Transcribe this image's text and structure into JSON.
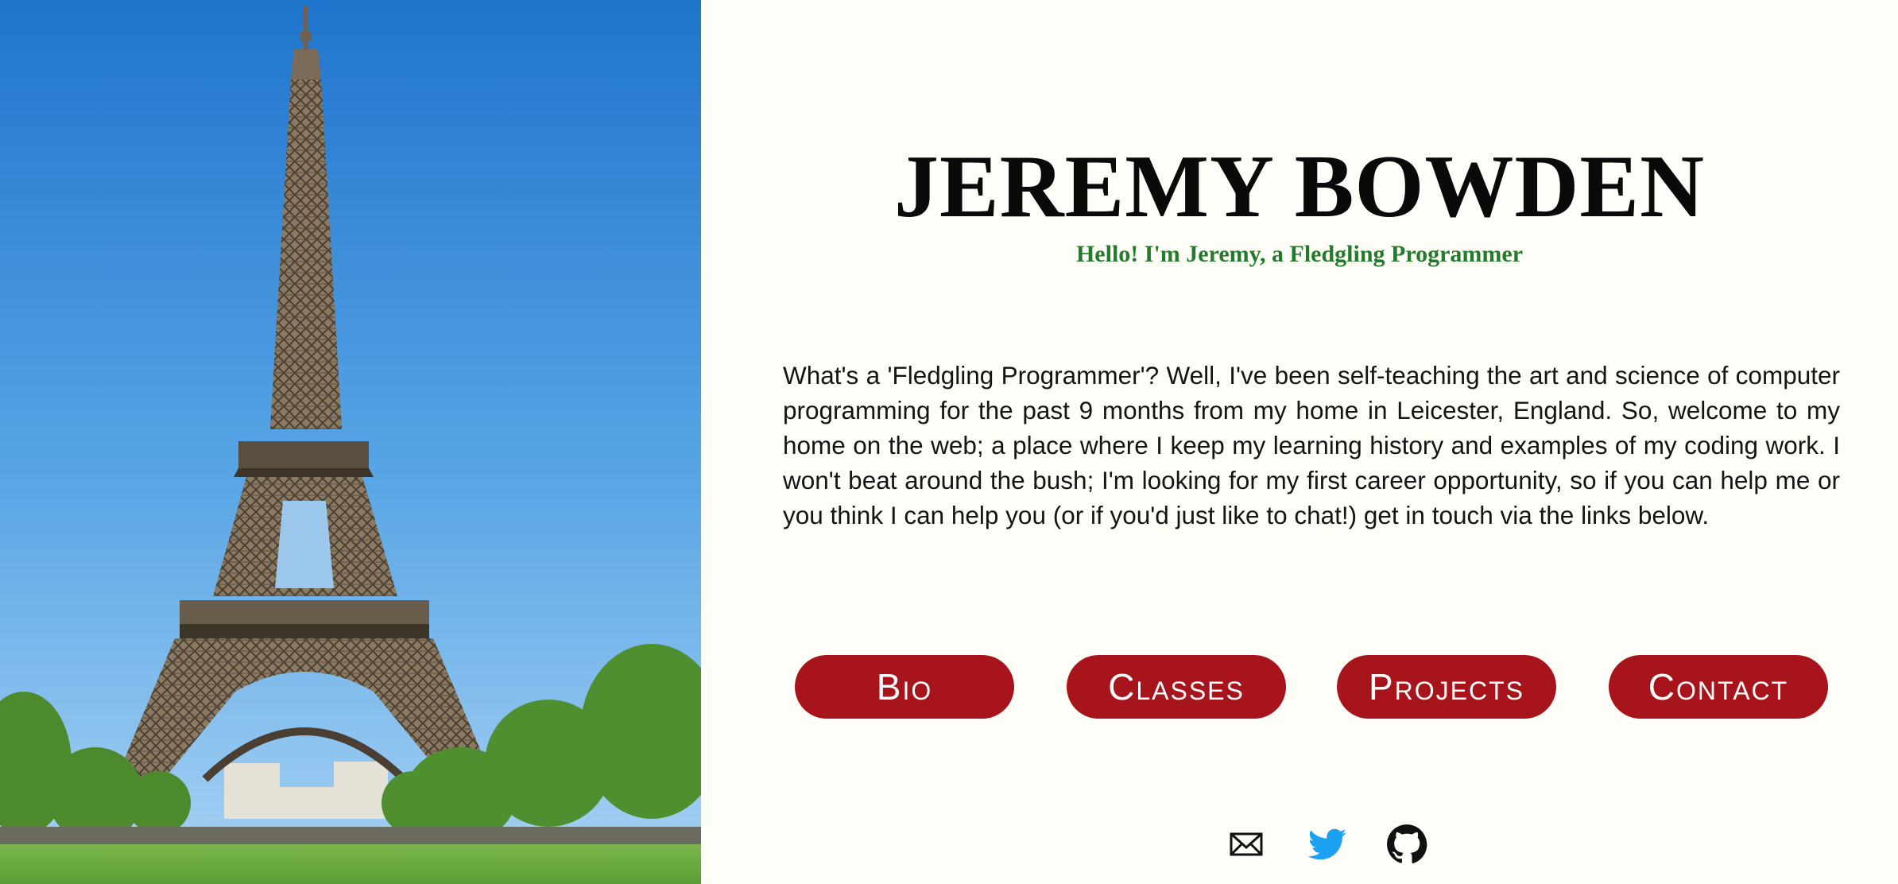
{
  "header": {
    "title": "JEREMY BOWDEN",
    "subtitle": "Hello! I'm Jeremy, a Fledgling Programmer"
  },
  "intro": {
    "text": "What's a 'Fledgling Programmer'? Well, I've been self-teaching the art and science of computer programming for the past 9 months from my home in Leicester, England. So, welcome to my home on the web; a place where I keep my learning history and examples of my coding work. I won't beat around the bush; I'm looking for my first career opportunity, so if you can help me or you think I can help you (or if you'd just like to chat!) get in touch via the links below."
  },
  "nav": {
    "items": [
      {
        "label": "Bio"
      },
      {
        "label": "Classes"
      },
      {
        "label": "Projects"
      },
      {
        "label": "Contact"
      }
    ]
  },
  "socials": [
    {
      "icon": "envelope-icon"
    },
    {
      "icon": "twitter-icon"
    },
    {
      "icon": "github-icon"
    }
  ],
  "colors": {
    "background": "#fefdf8",
    "title": "#0a0a0a",
    "subtitle": "#237a2b",
    "button": "#a8141b",
    "button_text": "#ffffff",
    "twitter": "#1da1f2"
  }
}
